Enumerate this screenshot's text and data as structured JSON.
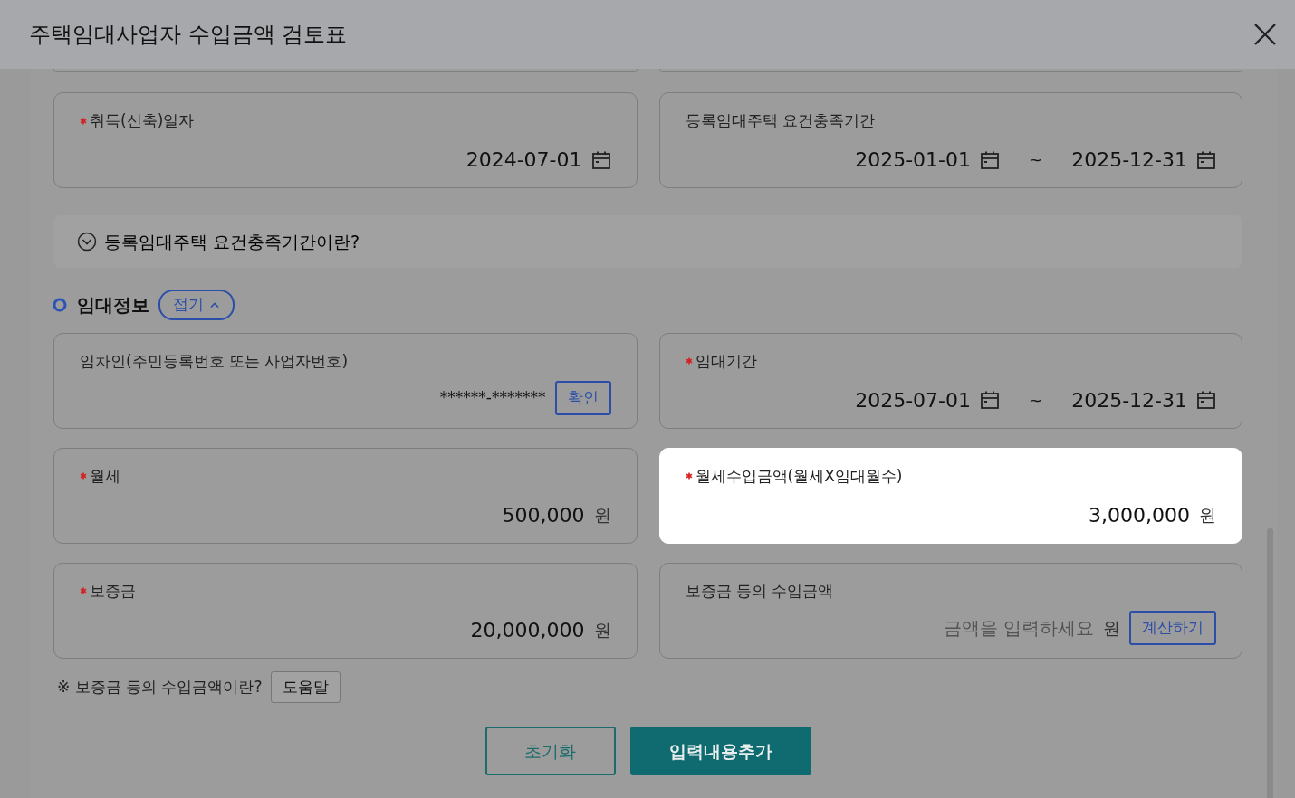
{
  "dialog": {
    "title": "주택임대사업자 수입금액 검토표"
  },
  "top_fields": [
    {
      "kind": "date",
      "label": "취득(신축)일자",
      "required": true,
      "value": "2024-07-01"
    },
    {
      "kind": "date-range",
      "label": "등록임대주택 요건충족기간",
      "required": false,
      "start": "2025-01-01",
      "separator": "~",
      "end": "2025-12-31"
    }
  ],
  "info_toggle": {
    "label": "등록임대주택 요건충족기간이란?",
    "expanded": false
  },
  "section": {
    "title": "임대정보",
    "toggle": "접기",
    "expanded": true
  },
  "fields": [
    {
      "kind": "id-check",
      "label": "임차인(주민등록번호 또는 사업자번호)",
      "required": false,
      "value": "******-*******",
      "button": "확인",
      "highlighted": false
    },
    {
      "kind": "date-range",
      "label": "임대기간",
      "required": true,
      "start": "2025-07-01",
      "separator": "~",
      "end": "2025-12-31",
      "highlighted": false
    },
    {
      "kind": "amount",
      "label": "월세",
      "required": true,
      "value": "500,000",
      "unit": "원",
      "highlighted": false
    },
    {
      "kind": "amount",
      "label": "월세수입금액(월세X임대월수)",
      "required": true,
      "value": "3,000,000",
      "unit": "원",
      "highlighted": true
    },
    {
      "kind": "amount",
      "label": "보증금",
      "required": true,
      "value": "20,000,000",
      "unit": "원",
      "highlighted": false
    },
    {
      "kind": "amount-calc",
      "label": "보증금 등의 수입금액",
      "required": false,
      "placeholder": "금액을 입력하세요",
      "unit": "원",
      "button": "계산하기",
      "highlighted": false
    }
  ],
  "help": {
    "text": "※ 보증금 등의 수입금액이란?",
    "button": "도움말"
  },
  "actions": [
    {
      "label": "초기화",
      "kind": "outline"
    },
    {
      "label": "입력내용추가",
      "kind": "primary"
    }
  ]
}
